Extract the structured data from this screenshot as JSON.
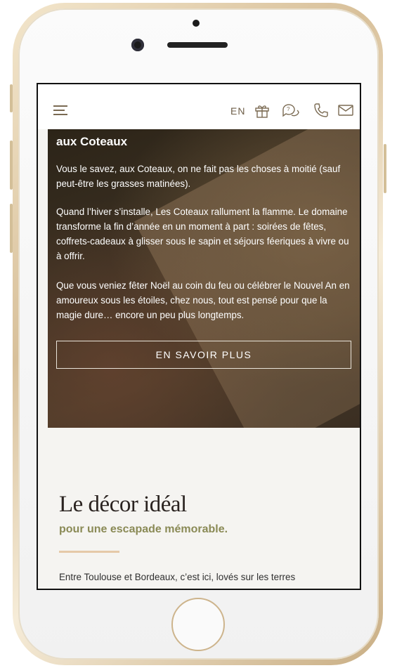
{
  "header": {
    "lang": "EN",
    "icons": [
      "menu-icon",
      "gift-icon",
      "chat-icon",
      "phone-icon",
      "mail-icon"
    ]
  },
  "hero": {
    "title": "aux Coteaux",
    "p1": "Vous le savez, aux Coteaux, on ne fait pas les choses à moitié (sauf peut-être les grasses matinées).",
    "p2": "Quand l’hiver s’installe, Les Coteaux rallument la flamme. Le domaine transforme la fin d’année en un moment à part : soirées de fêtes, coffrets-cadeaux à glisser sous le sapin et séjours féeriques à vivre ou à offrir.",
    "p3": "Que vous veniez fêter Noël au coin du feu ou célébrer le Nouvel An en amoureux sous les étoiles, chez nous, tout est pensé pour que la magie dure… encore un peu plus longtemps.",
    "cta": "EN SAVOIR PLUS"
  },
  "section": {
    "title": "Le décor idéal",
    "subtitle": "pour une escapade mémorable.",
    "body": "Entre Toulouse et Bordeaux, c’est ici, lovés sur les terres"
  },
  "colors": {
    "accent": "#8a8a56",
    "rule": "#e5c9a8",
    "icon": "#7a6a52"
  }
}
